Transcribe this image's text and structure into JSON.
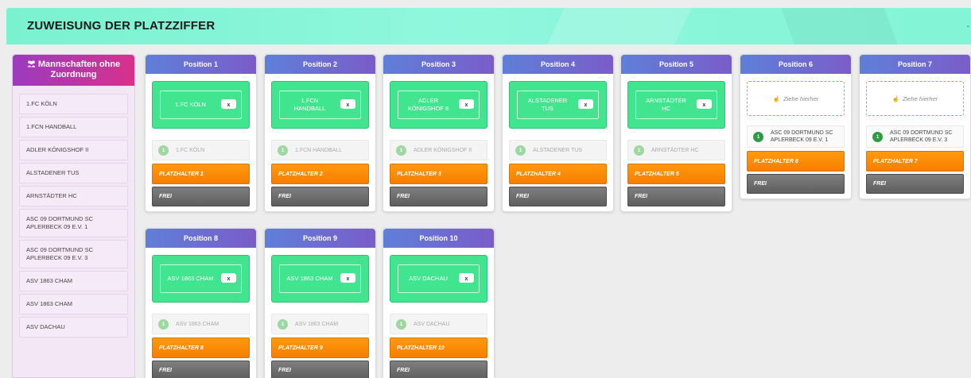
{
  "header": {
    "title": "ZUWEISUNG DER PLATZZIFFER",
    "dash": "-"
  },
  "sidebar": {
    "icon": "users-icon",
    "title": "Mannschaften ohne Zuordnung",
    "items": [
      "1.FC KÖLN",
      "1.FCN HANDBALL",
      "ADLER KÖNIGSHOF II",
      "ALSTADENER TUS",
      "ARNSTÄDTER HC",
      "ASC 09 DORTMUND SC APLERBECK 09 E.V. 1",
      "ASC 09 DORTMUND SC APLERBECK 09 E.V. 3",
      "ASV 1863 CHAM",
      "ASV 1863 CHAM",
      "ASV DACHAU"
    ]
  },
  "positions": [
    {
      "title": "Position 1",
      "assigned": "1.FC KÖLN",
      "team": "1.FC KÖLN",
      "badge": "1",
      "placeholder": "PLATZHALTER 1",
      "free": "FREI"
    },
    {
      "title": "Position 2",
      "assigned": "1.FCN HANDBALL",
      "team": "1.FCN HANDBALL",
      "badge": "1",
      "placeholder": "PLATZHALTER 2",
      "free": "FREI"
    },
    {
      "title": "Position 3",
      "assigned": "ADLER KÖNIGSHOF II",
      "team": "ADLER KÖNIGSHOF II",
      "badge": "1",
      "placeholder": "PLATZHALTER 3",
      "free": "FREI"
    },
    {
      "title": "Position 4",
      "assigned": "ALSTADENER TUS",
      "team": "ALSTADENER TUS",
      "badge": "1",
      "placeholder": "PLATZHALTER 4",
      "free": "FREI"
    },
    {
      "title": "Position 5",
      "assigned": "ARNSTÄDTER HC",
      "team": "ARNSTÄDTER HC",
      "badge": "1",
      "placeholder": "PLATZHALTER 5",
      "free": "FREI"
    },
    {
      "title": "Position 6",
      "assigned": "",
      "drop_hint": "Ziehe hierher",
      "team": "ASC 09 DORTMUND SC APLERBECK 09 E.V. 1",
      "badge": "1",
      "placeholder": "PLATZHALTER 6",
      "free": "FREI"
    },
    {
      "title": "Position 7",
      "assigned": "",
      "drop_hint": "Ziehe hierher",
      "team": "ASC 09 DORTMUND SC APLERBECK 09 E.V. 3",
      "badge": "1",
      "placeholder": "PLATZHALTER 7",
      "free": "FREI"
    },
    {
      "title": "Position 8",
      "assigned": "ASV 1863 CHAM",
      "team": "ASV 1863 CHAM",
      "badge": "1",
      "placeholder": "PLATZHALTER 8",
      "free": "FREI"
    },
    {
      "title": "Position 9",
      "assigned": "ASV 1863 CHAM",
      "team": "ASV 1863 CHAM",
      "badge": "1",
      "placeholder": "PLATZHALTER 9",
      "free": "FREI"
    },
    {
      "title": "Position 10",
      "assigned": "ASV DACHAU",
      "team": "ASV DACHAU",
      "badge": "1",
      "placeholder": "PLATZHALTER 10",
      "free": "FREI"
    }
  ],
  "remove_button_glyph": "x",
  "colors": {
    "header": "#8ff7dd",
    "assigned": "#42e58f",
    "placeholder": "#f77e00",
    "free": "#6b6b6b",
    "position_header": "#6b6fd2",
    "sidebar_header": "#c2348f"
  }
}
